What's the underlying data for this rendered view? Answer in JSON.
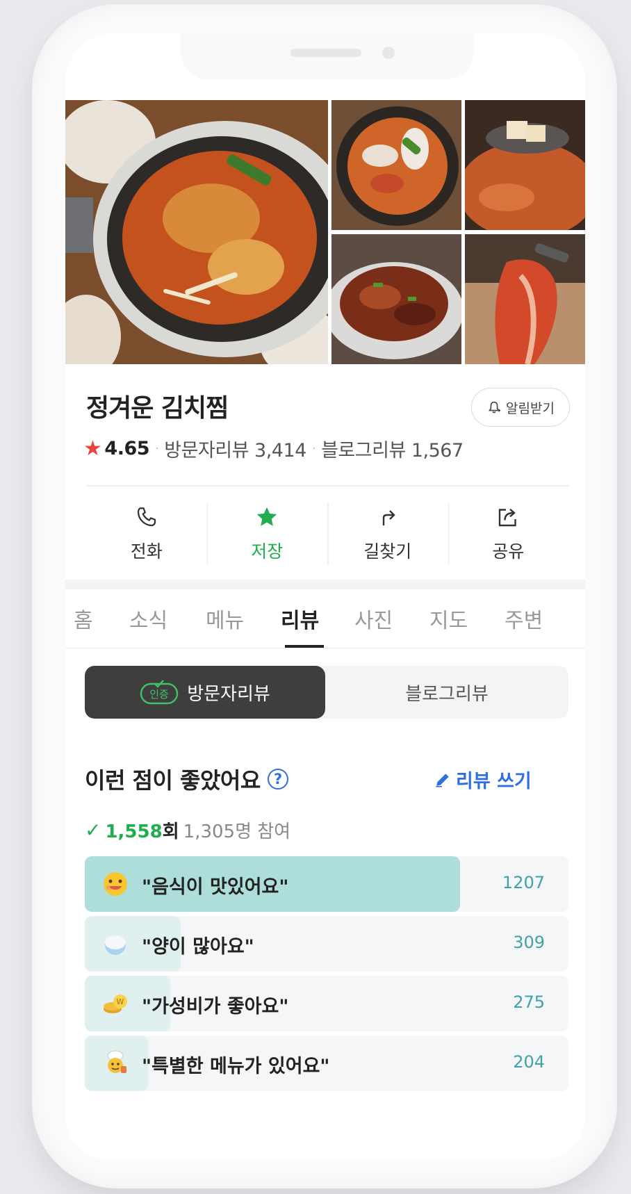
{
  "restaurant": {
    "name": "정겨운 김치찜",
    "rating": "4.65",
    "visitor_reviews": "방문자리뷰 3,414",
    "blog_reviews": "블로그리뷰 1,567",
    "alert_label": "알림받기"
  },
  "actions": [
    {
      "label": "전화",
      "icon": "phone-icon"
    },
    {
      "label": "저장",
      "icon": "star-icon"
    },
    {
      "label": "길찾기",
      "icon": "directions-icon"
    },
    {
      "label": "공유",
      "icon": "share-icon"
    }
  ],
  "tabs": [
    "홈",
    "소식",
    "메뉴",
    "리뷰",
    "사진",
    "지도",
    "주변"
  ],
  "active_tab": "리뷰",
  "segment": {
    "active": "방문자리뷰",
    "inactive": "블로그리뷰",
    "badge": "인증"
  },
  "likes": {
    "title": "이런 점이 좋았어요",
    "write_review": "리뷰 쓰기",
    "count": "1,558",
    "count_unit": "회",
    "participants": "1,305명 참여"
  },
  "chart_data": {
    "type": "bar",
    "categories": [
      "\"음식이 맛있어요\"",
      "\"양이 많아요\"",
      "\"가성비가 좋아요\"",
      "\"특별한 메뉴가 있어요\""
    ],
    "values": [
      1207,
      309,
      275,
      204
    ],
    "emojis": [
      "smiley-face-icon",
      "rice-bowl-icon",
      "coin-icon",
      "chef-icon"
    ],
    "colors": {
      "top": "#aeded9",
      "rest": "#dff0ee"
    }
  },
  "colors": {
    "accent_green": "#1eae4e",
    "link_blue": "#2f6fe4",
    "star_red": "#e8453c",
    "teal_value": "#3fa2a8"
  }
}
